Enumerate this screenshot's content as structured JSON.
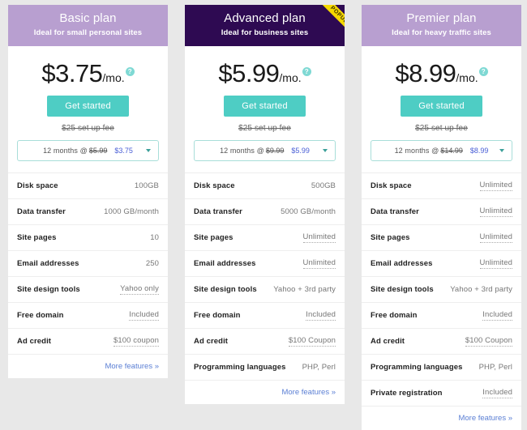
{
  "theme": {
    "page_background": "#e8e8e8",
    "card_background": "#ffffff",
    "header_light": "#b89fd0",
    "header_dark": "#2e0a52",
    "accent_teal": "#4ecdc4",
    "ribbon_yellow": "#f5d800",
    "link_blue": "#5b7fd4",
    "price_blue": "#4a5fd6"
  },
  "common": {
    "cta_label": "Get started",
    "setup_fee": "$25 set up fee",
    "help_icon": "question-mark-icon",
    "more_features": "More features »",
    "caret_icon": "chevron-down-icon",
    "per_month": "/mo."
  },
  "plans": [
    {
      "id": "basic",
      "title": "Basic plan",
      "subtitle": "Ideal for small personal sites",
      "header_style": "light",
      "popular": false,
      "price": "$3.75",
      "term": {
        "prefix": "12 months @",
        "old_price": "$5.99",
        "new_price": "$3.75"
      },
      "features": [
        {
          "label": "Disk space",
          "value": "100GB",
          "tooltip": false
        },
        {
          "label": "Data transfer",
          "value": "1000 GB/month",
          "tooltip": false
        },
        {
          "label": "Site pages",
          "value": "10",
          "tooltip": false
        },
        {
          "label": "Email addresses",
          "value": "250",
          "tooltip": false
        },
        {
          "label": "Site design tools",
          "value": "Yahoo only",
          "tooltip": true
        },
        {
          "label": "Free domain",
          "value": "Included",
          "tooltip": true
        },
        {
          "label": "Ad credit",
          "value": "$100 coupon",
          "tooltip": true
        }
      ]
    },
    {
      "id": "advanced",
      "title": "Advanced plan",
      "subtitle": "Ideal for business sites",
      "header_style": "dark",
      "popular": true,
      "ribbon_label": "POPULAR",
      "price": "$5.99",
      "term": {
        "prefix": "12 months @",
        "old_price": "$9.99",
        "new_price": "$5.99"
      },
      "features": [
        {
          "label": "Disk space",
          "value": "500GB",
          "tooltip": false
        },
        {
          "label": "Data transfer",
          "value": "5000 GB/month",
          "tooltip": false
        },
        {
          "label": "Site pages",
          "value": "Unlimited",
          "tooltip": true
        },
        {
          "label": "Email addresses",
          "value": "Unlimited",
          "tooltip": true
        },
        {
          "label": "Site design tools",
          "value": "Yahoo + 3rd party",
          "tooltip": false
        },
        {
          "label": "Free domain",
          "value": "Included",
          "tooltip": true
        },
        {
          "label": "Ad credit",
          "value": "$100 Coupon",
          "tooltip": true
        },
        {
          "label": "Programming languages",
          "value": "PHP, Perl",
          "tooltip": false
        }
      ]
    },
    {
      "id": "premier",
      "title": "Premier plan",
      "subtitle": "Ideal for heavy traffic sites",
      "header_style": "light",
      "popular": false,
      "price": "$8.99",
      "term": {
        "prefix": "12 months @",
        "old_price": "$14.99",
        "new_price": "$8.99"
      },
      "features": [
        {
          "label": "Disk space",
          "value": "Unlimited",
          "tooltip": true
        },
        {
          "label": "Data transfer",
          "value": "Unlimited",
          "tooltip": true
        },
        {
          "label": "Site pages",
          "value": "Unlimited",
          "tooltip": true
        },
        {
          "label": "Email addresses",
          "value": "Unlimited",
          "tooltip": true
        },
        {
          "label": "Site design tools",
          "value": "Yahoo + 3rd party",
          "tooltip": false
        },
        {
          "label": "Free domain",
          "value": "Included",
          "tooltip": true
        },
        {
          "label": "Ad credit",
          "value": "$100 Coupon",
          "tooltip": true
        },
        {
          "label": "Programming languages",
          "value": "PHP, Perl",
          "tooltip": false
        },
        {
          "label": "Private registration",
          "value": "Included",
          "tooltip": true
        }
      ]
    }
  ]
}
